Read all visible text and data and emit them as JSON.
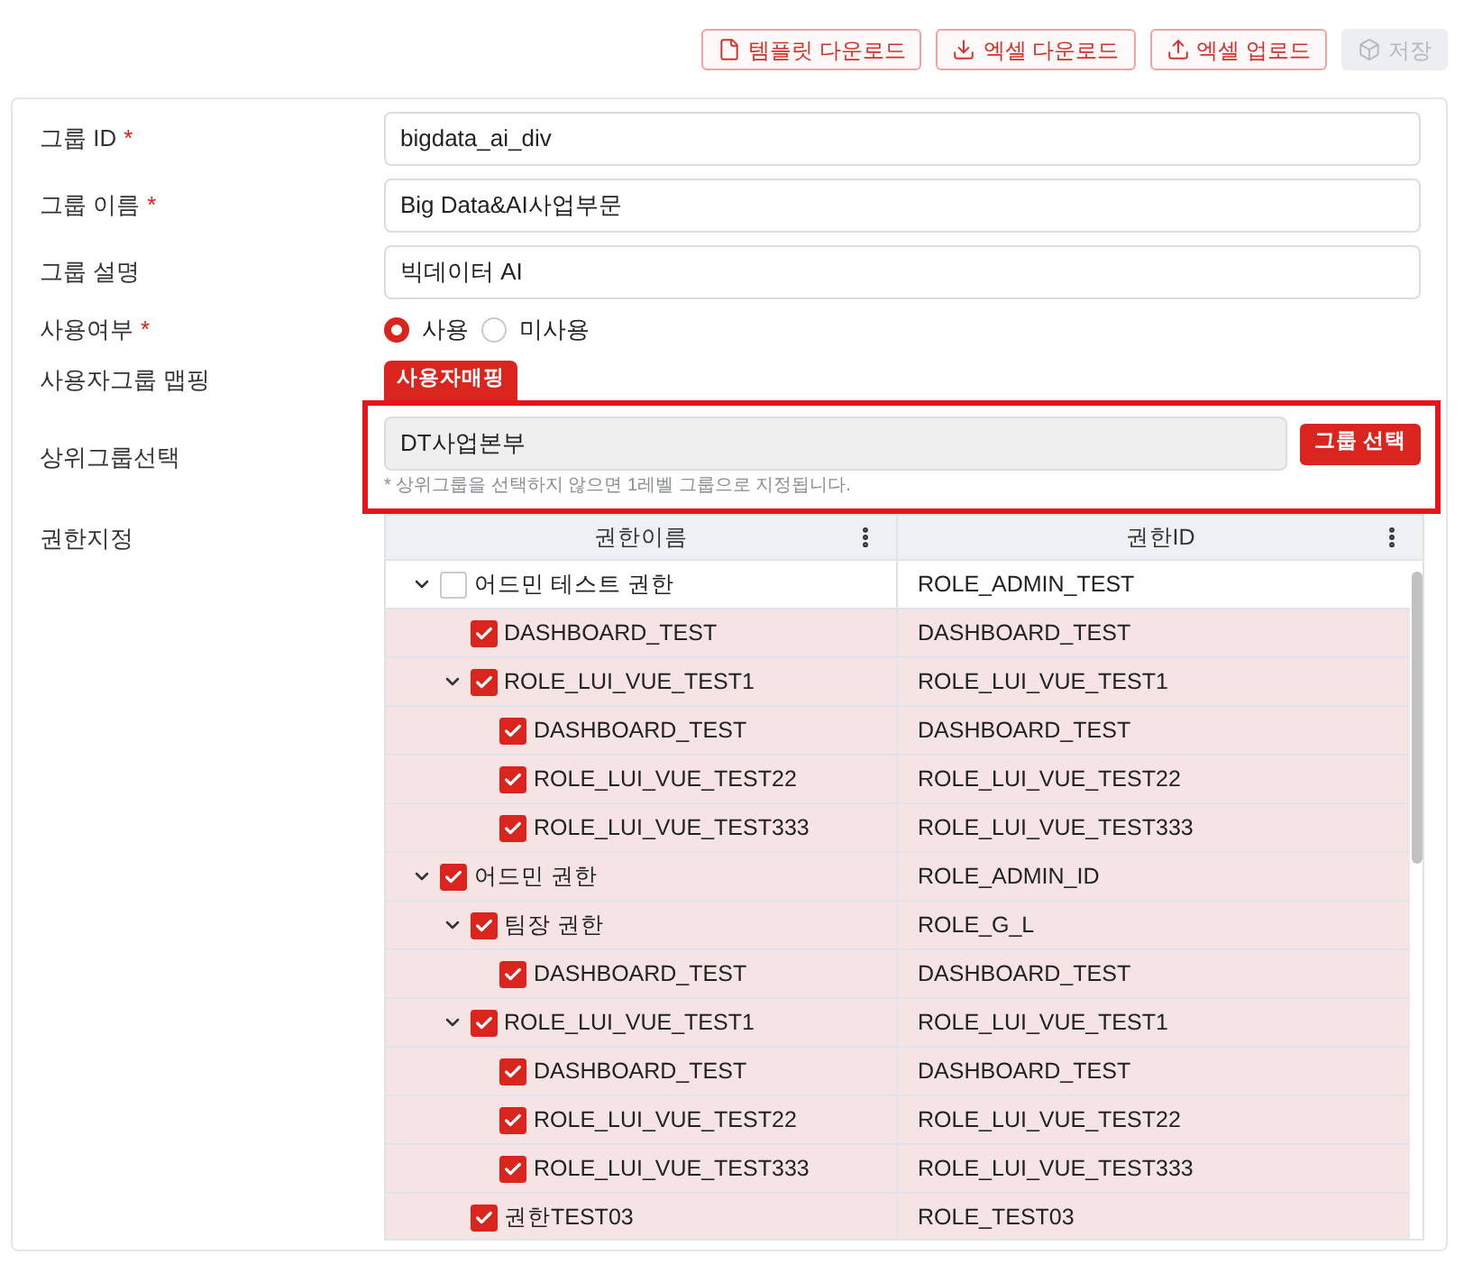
{
  "toolbar": {
    "buttons": [
      {
        "kind": "template",
        "label": "템플릿 다운로드",
        "disabled": false
      },
      {
        "kind": "download",
        "label": "엑셀 다운로드",
        "disabled": false
      },
      {
        "kind": "upload",
        "label": "엑셀 업로드",
        "disabled": false
      },
      {
        "kind": "save",
        "label": "저장",
        "disabled": true
      }
    ]
  },
  "form": {
    "fields": [
      {
        "kind": "input",
        "label": "그룹 ID",
        "required_mark": "*",
        "value": "bigdata_ai_div"
      },
      {
        "kind": "input",
        "label": "그룹 이름",
        "required_mark": "*",
        "value": "Big Data&AI사업부문"
      },
      {
        "kind": "input",
        "label": "그룹 설명",
        "value": "빅데이터 AI"
      },
      {
        "kind": "radio",
        "label": "사용여부",
        "required_mark": "*",
        "options": [
          {
            "label": "사용",
            "selected": true
          },
          {
            "label": "미사용",
            "selected": false
          }
        ]
      },
      {
        "kind": "button",
        "label": "사용자그룹 맵핑",
        "button": "사용자매핑"
      },
      {
        "kind": "picker",
        "label": "상위그룹선택",
        "value": "DT사업본부",
        "button": "그룹 선택",
        "hint": "* 상위그룹을 선택하지 않으면 1레벨 그룹으로 지정됩니다.",
        "highlighted": true
      },
      {
        "kind": "tree",
        "label": "권한지정",
        "columns": [
          "권한이름",
          "권한ID"
        ],
        "rows": [
          {
            "name": "어드민 테스트 권한",
            "id": "ROLE_ADMIN_TEST",
            "checked": false,
            "expanded": true,
            "children": [
              {
                "name": "DASHBOARD_TEST",
                "id": "DASHBOARD_TEST",
                "checked": true
              },
              {
                "name": "ROLE_LUI_VUE_TEST1",
                "id": "ROLE_LUI_VUE_TEST1",
                "checked": true,
                "expanded": true,
                "children": [
                  {
                    "name": "DASHBOARD_TEST",
                    "id": "DASHBOARD_TEST",
                    "checked": true
                  },
                  {
                    "name": "ROLE_LUI_VUE_TEST22",
                    "id": "ROLE_LUI_VUE_TEST22",
                    "checked": true
                  },
                  {
                    "name": "ROLE_LUI_VUE_TEST333",
                    "id": "ROLE_LUI_VUE_TEST333",
                    "checked": true
                  }
                ]
              }
            ]
          },
          {
            "name": "어드민 권한",
            "id": "ROLE_ADMIN_ID",
            "checked": true,
            "expanded": true,
            "children": [
              {
                "name": "팀장 권한",
                "id": "ROLE_G_L",
                "checked": true,
                "expanded": true,
                "children": [
                  {
                    "name": "DASHBOARD_TEST",
                    "id": "DASHBOARD_TEST",
                    "checked": true
                  }
                ]
              },
              {
                "name": "ROLE_LUI_VUE_TEST1",
                "id": "ROLE_LUI_VUE_TEST1",
                "checked": true,
                "expanded": true,
                "children": [
                  {
                    "name": "DASHBOARD_TEST",
                    "id": "DASHBOARD_TEST",
                    "checked": true
                  },
                  {
                    "name": "ROLE_LUI_VUE_TEST22",
                    "id": "ROLE_LUI_VUE_TEST22",
                    "checked": true
                  },
                  {
                    "name": "ROLE_LUI_VUE_TEST333",
                    "id": "ROLE_LUI_VUE_TEST333",
                    "checked": true
                  }
                ]
              },
              {
                "name": "권한TEST03",
                "id": "ROLE_TEST03",
                "checked": true
              }
            ]
          }
        ]
      }
    ]
  }
}
